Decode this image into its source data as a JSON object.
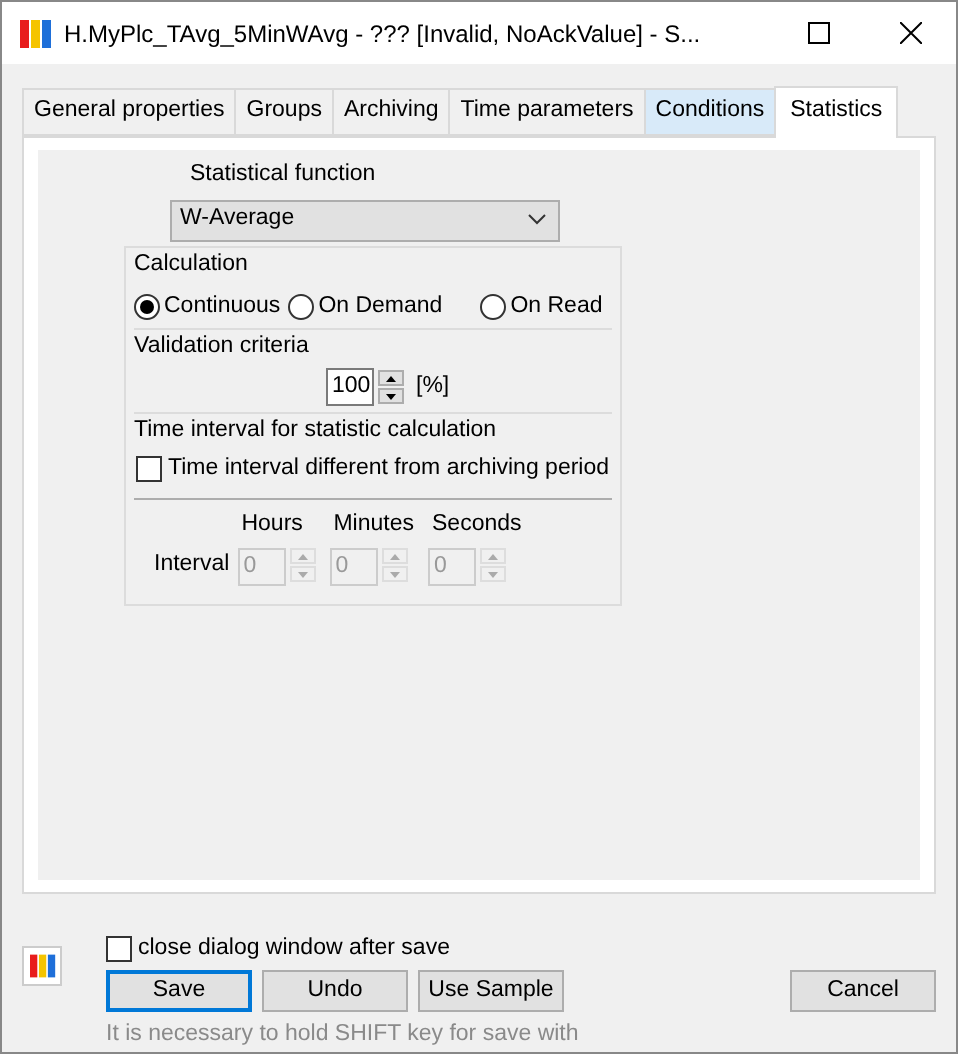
{
  "window": {
    "title": "H.MyPlc_TAvg_5MinWAvg - ??? [Invalid, NoAckValue] - S..."
  },
  "tabs": [
    {
      "label": "General properties",
      "selected": false,
      "hovered": false
    },
    {
      "label": "Groups",
      "selected": false,
      "hovered": false
    },
    {
      "label": "Archiving",
      "selected": false,
      "hovered": false
    },
    {
      "label": "Time parameters",
      "selected": false,
      "hovered": false
    },
    {
      "label": "Conditions",
      "selected": false,
      "hovered": true
    },
    {
      "label": "Statistics",
      "selected": true,
      "hovered": false
    }
  ],
  "statistical_function": {
    "label": "Statistical function",
    "value": "W-Average"
  },
  "calculation": {
    "title": "Calculation",
    "options": [
      {
        "label": "Continuous",
        "selected": true
      },
      {
        "label": "On Demand",
        "selected": false
      },
      {
        "label": "On Read",
        "selected": false
      }
    ]
  },
  "validation": {
    "title": "Validation criteria",
    "value": "100",
    "unit": "[%]"
  },
  "time_interval": {
    "title": "Time interval for statistic calculation",
    "checkbox": {
      "label": "Time interval different from archiving period",
      "checked": false
    },
    "label": "Interval",
    "fields": [
      {
        "header": "Hours",
        "value": "0",
        "disabled": true
      },
      {
        "header": "Minutes",
        "value": "0",
        "disabled": true
      },
      {
        "header": "Seconds",
        "value": "0",
        "disabled": true
      }
    ]
  },
  "footer": {
    "close_checkbox": {
      "label": "close dialog window after save",
      "checked": false
    },
    "buttons": [
      {
        "label": "Save",
        "focused": true
      },
      {
        "label": "Undo",
        "focused": false
      },
      {
        "label": "Use Sample",
        "focused": false
      },
      {
        "label": "Cancel",
        "focused": false
      }
    ],
    "hint": "It is necessary to hold SHIFT key for save with"
  }
}
